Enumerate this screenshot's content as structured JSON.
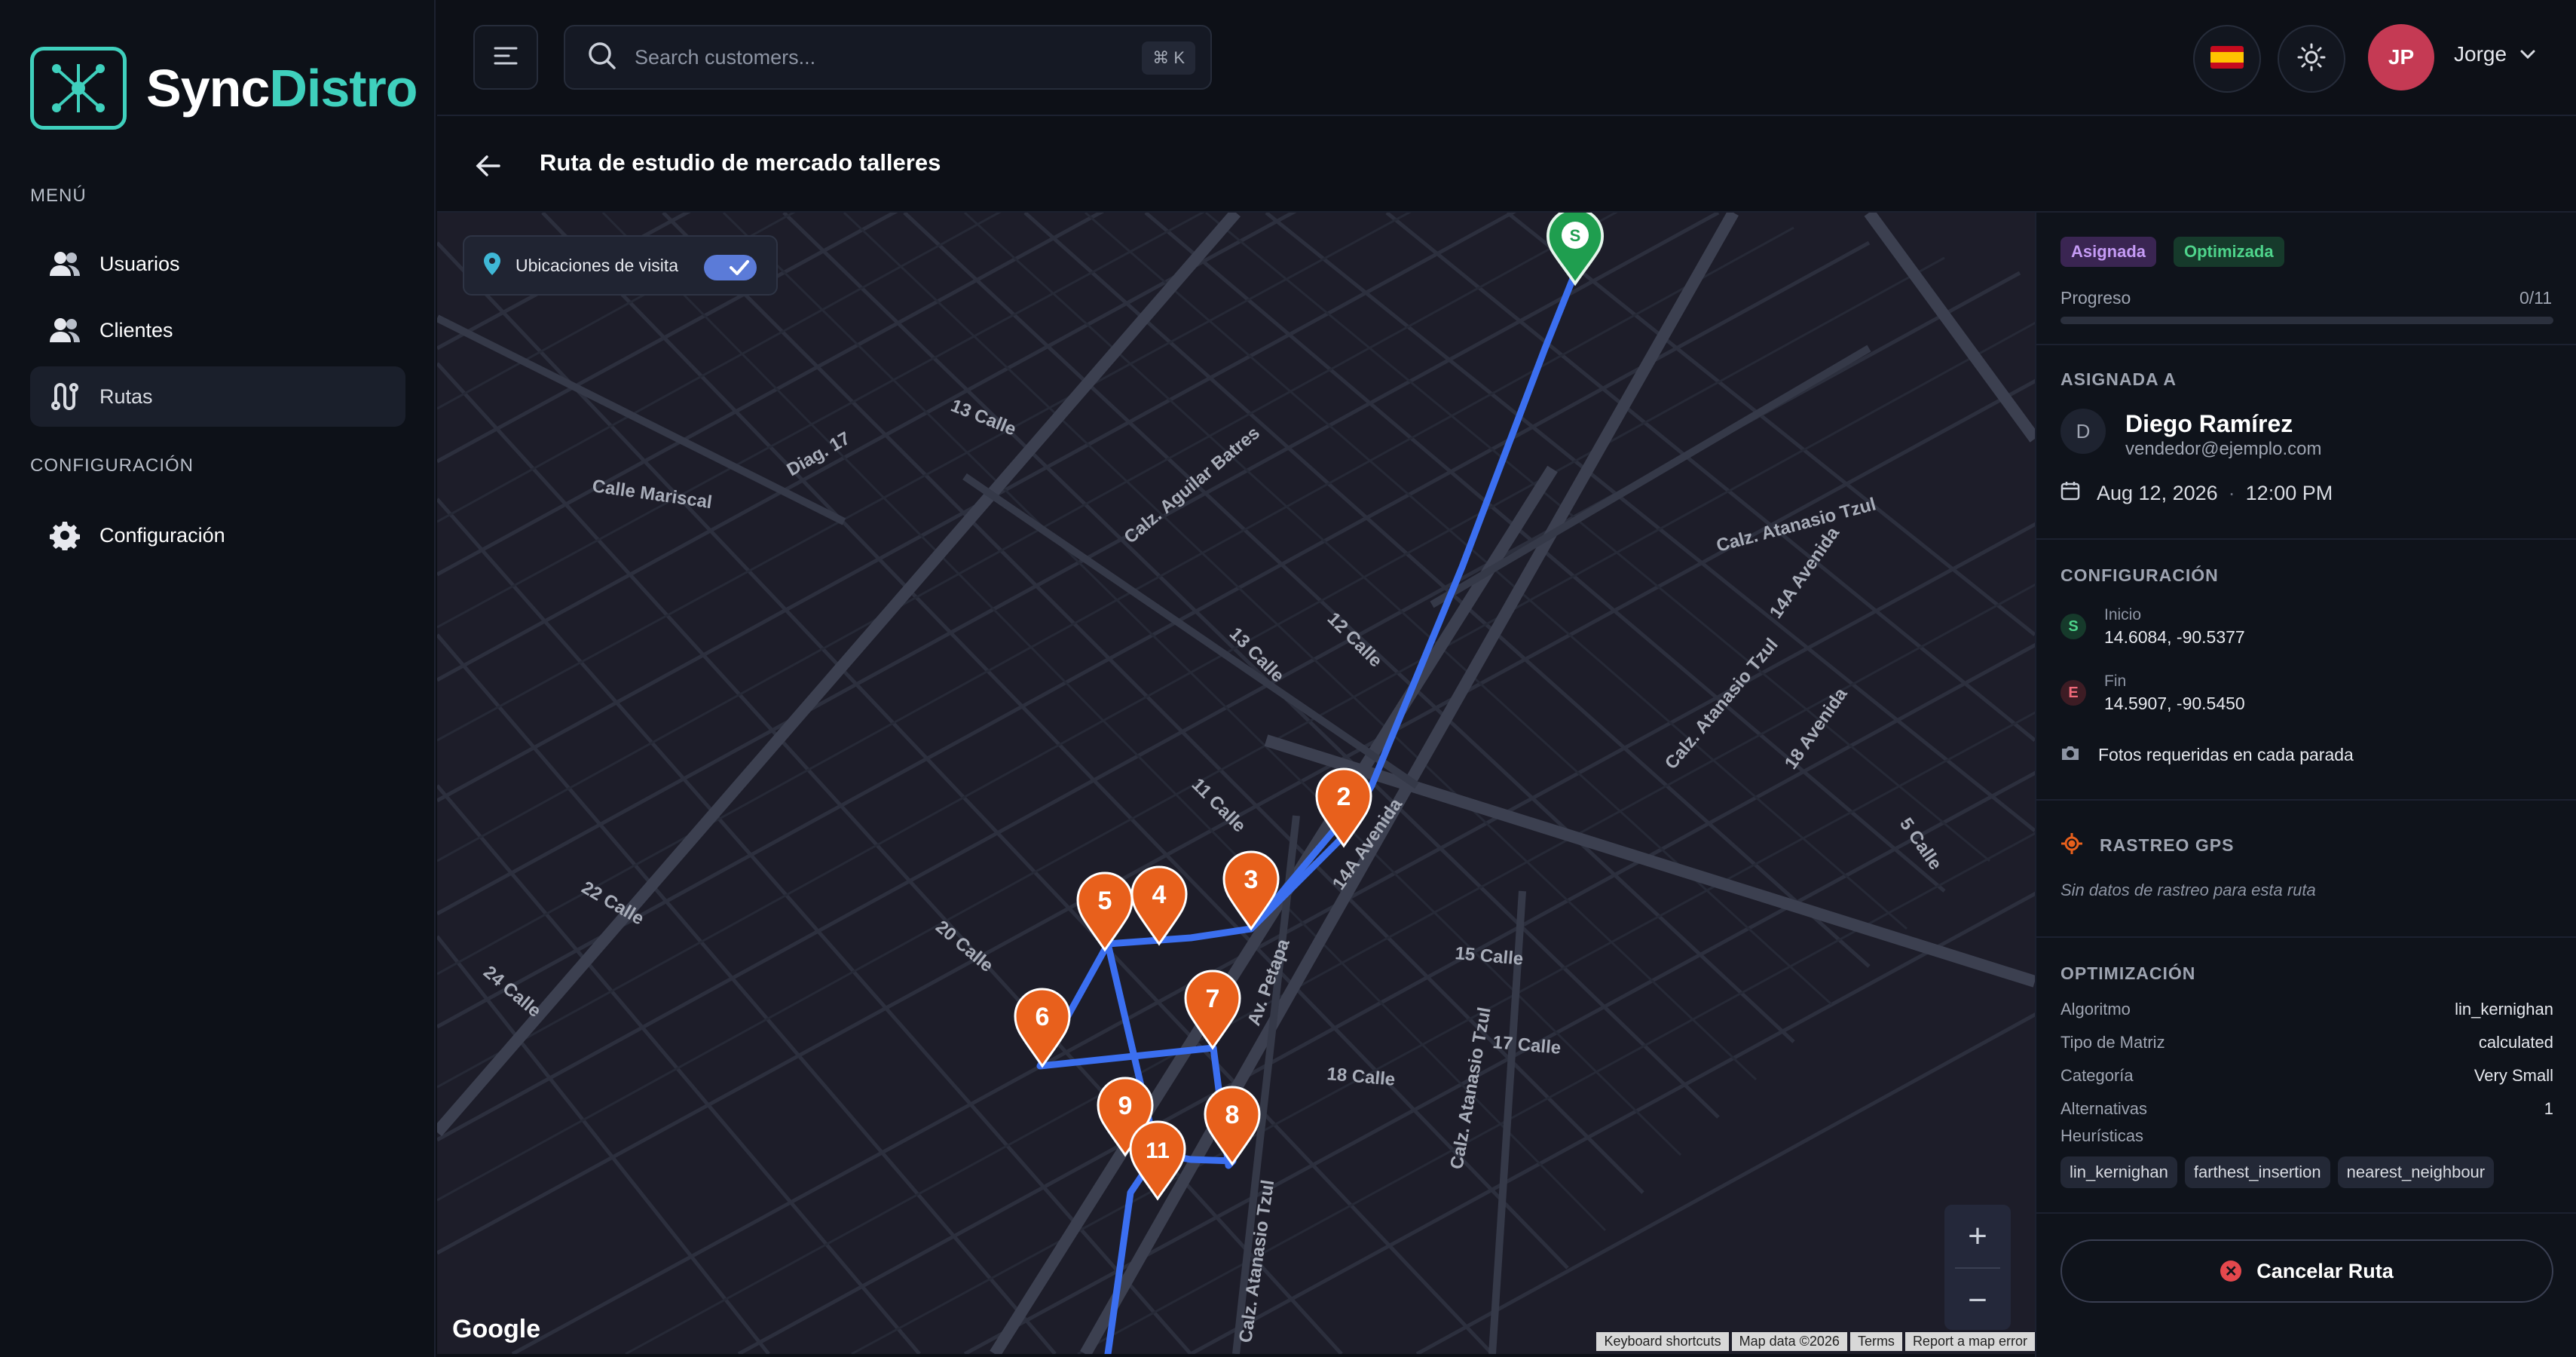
{
  "app": {
    "logo_part1": "Sync",
    "logo_part2": "Distro"
  },
  "sidebar": {
    "menu_label": "MENÚ",
    "items": [
      {
        "label": "Usuarios",
        "icon": "users-icon"
      },
      {
        "label": "Clientes",
        "icon": "clients-icon"
      },
      {
        "label": "Rutas",
        "icon": "route-icon",
        "active": true
      }
    ],
    "config_label": "CONFIGURACIÓN",
    "config_items": [
      {
        "label": "Configuración",
        "icon": "gear-icon"
      }
    ]
  },
  "topbar": {
    "search_placeholder": "Search customers...",
    "shortcut": "⌘ K",
    "language_flag": "spain-flag-icon",
    "user_initials": "JP",
    "user_name": "Jorge"
  },
  "page": {
    "title": "Ruta de estudio de mercado talleres"
  },
  "map": {
    "layer_toggle_label": "Ubicaciones de visita",
    "layer_toggle_on": true,
    "zoom_in": "+",
    "zoom_out": "−",
    "provider": "Google",
    "attribution": [
      "Keyboard shortcuts",
      "Map data ©2026",
      "Terms",
      "Report a map error"
    ],
    "start_label": "S",
    "stops": [
      "2",
      "3",
      "4",
      "5",
      "6",
      "7",
      "8",
      "9",
      "11"
    ],
    "street_labels": [
      "13 Calle",
      "Calle Mariscal",
      "Diag. 17",
      "Calz. Aguilar Batres",
      "12 Calle",
      "13 Calle",
      "14A Avenida",
      "Av. Petapa",
      "Calz. Atanasio Tzul",
      "Calz. Atanasio Tzul",
      "14A Avenida",
      "18 Avenida",
      "Calz. Atanasio Tzul",
      "17 Calle",
      "18 Calle",
      "15 Calle",
      "20 Calle",
      "22 Calle",
      "24 Calle",
      "5 Calle",
      "Calz. Atanasio Tzul",
      "11 Calle"
    ]
  },
  "panel": {
    "badges": [
      "Asignada",
      "Optimizada"
    ],
    "progress_label": "Progreso",
    "progress_value": "0/11",
    "progress_fraction": 0,
    "assigned_caption": "ASIGNADA A",
    "assignee_initial": "D",
    "assignee_name": "Diego Ramírez",
    "assignee_email": "vendedor@ejemplo.com",
    "date": "Aug 12, 2026",
    "time": "12:00 PM",
    "config_caption": "CONFIGURACIÓN",
    "start": {
      "badge": "S",
      "label": "Inicio",
      "value": "14.6084, -90.5377"
    },
    "end": {
      "badge": "E",
      "label": "Fin",
      "value": "14.5907, -90.5450"
    },
    "photos_text": "Fotos requeridas en cada parada",
    "gps_caption": "RASTREO GPS",
    "gps_empty": "Sin datos de rastreo para esta ruta",
    "optimization_caption": "OPTIMIZACIÓN",
    "optimization": [
      {
        "label": "Algoritmo",
        "value": "lin_kernighan"
      },
      {
        "label": "Tipo de Matriz",
        "value": "calculated"
      },
      {
        "label": "Categoría",
        "value": "Very Small"
      },
      {
        "label": "Alternativas",
        "value": "1"
      }
    ],
    "heuristics_label": "Heurísticas",
    "heuristics": [
      "lin_kernighan",
      "farthest_insertion",
      "nearest_neighbour"
    ],
    "cancel_label": "Cancelar Ruta"
  },
  "colors": {
    "accent": "#3fd0bd",
    "route": "#3b6ff0",
    "pin": "#e8601c",
    "start_pin": "#1f9e4f",
    "danger": "#e5484d"
  }
}
